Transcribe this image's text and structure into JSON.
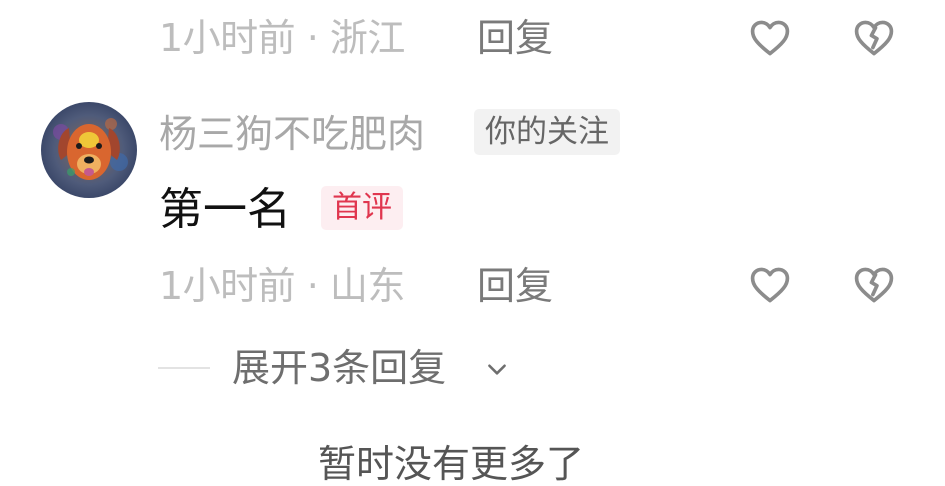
{
  "prev_comment": {
    "time_location": "1小时前 · 浙江",
    "reply_label": "回复"
  },
  "comment": {
    "username": "杨三狗不吃肥肉",
    "follow_badge": "你的关注",
    "text": "第一名",
    "first_badge": "首评",
    "time_location": "1小时前 · 山东",
    "reply_label": "回复",
    "expand_replies_label": "展开3条回复"
  },
  "footer": {
    "text": "暂时没有更多了"
  },
  "icons": {
    "like": "heart-icon",
    "dislike": "broken-heart-icon",
    "expand": "chevron-down-icon"
  },
  "colors": {
    "first_badge_text": "#e0364f",
    "first_badge_bg": "#fdeef1",
    "follow_badge_bg": "#f2f2f2"
  }
}
